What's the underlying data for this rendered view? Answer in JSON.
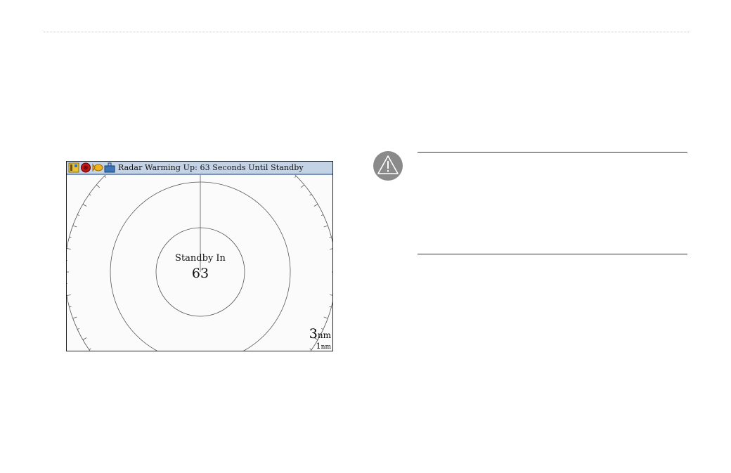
{
  "radar": {
    "status_message": "Radar Warming Up: 63 Seconds Until Standby",
    "standby_label": "Standby In",
    "countdown": "63",
    "range_outer_value": "3",
    "range_outer_unit": "nm",
    "range_inner_value": "1",
    "range_inner_unit": "nm",
    "status_icons": [
      "gps-icon",
      "alarm-icon",
      "sonar-fish-icon",
      "radar-tower-icon"
    ]
  },
  "note": {
    "icon": "warning-icon"
  },
  "colors": {
    "status_bar": "#c4d2e6",
    "status_bar_border": "#7a95bd",
    "screen_bg": "#fbfbfb",
    "rings": "#555555",
    "warning_circle": "#8a8a8a"
  }
}
